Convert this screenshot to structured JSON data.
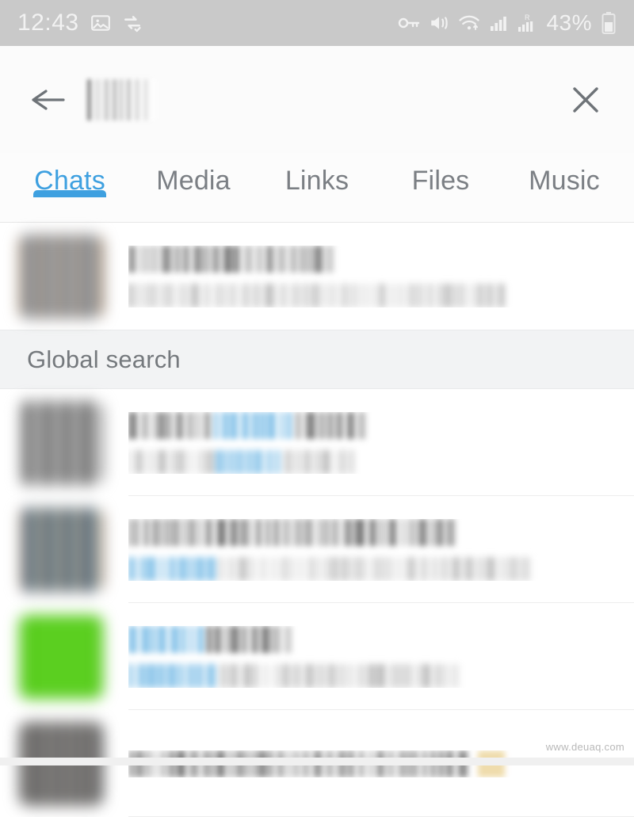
{
  "status_bar": {
    "time": "12:43",
    "battery_percent": "43%",
    "background_color": "#c9c9c9",
    "foreground_color": "#f2f2f2",
    "left_icons": [
      "image-icon",
      "data-sync-icon"
    ],
    "right_icons": [
      "vpn-key-icon",
      "mute-icon",
      "wifi-icon",
      "signal-icon",
      "roaming-signal-icon"
    ],
    "battery_icon": "battery-icon"
  },
  "app_bar": {
    "back_icon": "back-arrow-icon",
    "close_icon": "close-icon",
    "search_value": "",
    "search_placeholder": "",
    "search_redacted": true,
    "background_color": "#fbfbfb"
  },
  "tabs": {
    "active_color": "#3ea0e0",
    "inactive_color": "#7b7f84",
    "active_index": 0,
    "items": [
      {
        "label": "Chats"
      },
      {
        "label": "Media"
      },
      {
        "label": "Links"
      },
      {
        "label": "Files"
      },
      {
        "label": "Music"
      }
    ]
  },
  "top_results": {
    "rows": [
      {
        "avatar_colors": [
          "#b9a38c",
          "#6f5a47",
          "#a8bed4",
          "#5c6d82",
          "#c9c2ba"
        ],
        "title_redacted": true,
        "subtitle_redacted": true,
        "title_highlight": false,
        "subtitle_highlight": false
      }
    ]
  },
  "global_search": {
    "header": "Global search",
    "header_background": "#f2f3f4",
    "highlight_color": "#8dc6ea",
    "rows": [
      {
        "avatar_colors": [
          "#d8d8d8",
          "#6d6d6d",
          "#2e2e2e",
          "#8a8a8a",
          "#d0d0d0"
        ],
        "title_redacted": true,
        "subtitle_redacted": true,
        "title_highlight": true,
        "subtitle_highlight": true
      },
      {
        "avatar_colors": [
          "#c9cbc4",
          "#7d5f4a",
          "#2f4e72",
          "#3d5f86",
          "#a9b79c"
        ],
        "title_redacted": true,
        "subtitle_redacted": true,
        "title_highlight": false,
        "subtitle_highlight": true
      },
      {
        "avatar_colors": [
          "#5fd21f",
          "#49c411",
          "#73dd3a",
          "#4cc514",
          "#5ed020"
        ],
        "title_redacted": true,
        "subtitle_redacted": true,
        "title_highlight": true,
        "subtitle_highlight": true
      },
      {
        "avatar_colors": [
          "#6e6e6e",
          "#4a4a4a",
          "#c5bdb6",
          "#3c3c3c",
          "#8d8d8d"
        ],
        "title_redacted": true,
        "subtitle_redacted": false,
        "title_highlight": false,
        "subtitle_highlight": false,
        "badge_color": "#efdcac"
      }
    ]
  },
  "watermark": {
    "text": "www.deuaq.com"
  }
}
